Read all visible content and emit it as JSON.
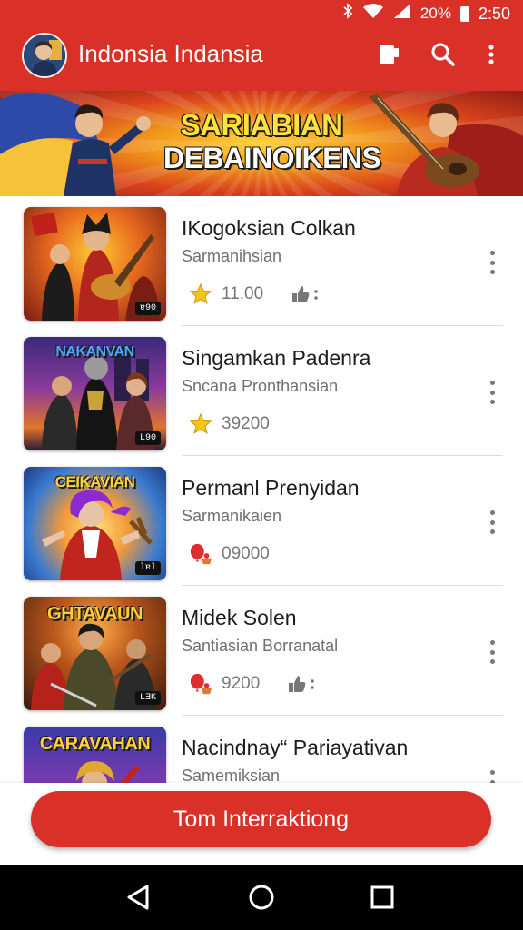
{
  "status_bar": {
    "battery": "20%",
    "time": "2:50"
  },
  "app_bar": {
    "title": "Indonsia Indansia"
  },
  "banner": {
    "line1": "SARIABIAN",
    "line2": "DEBAINOIKENS"
  },
  "items": [
    {
      "title": "IKogoksian Colkan",
      "subtitle": "Sarmanihsian",
      "meta_icon": "star-icon",
      "value": "11.00",
      "extra_icon": "thumb-icon",
      "thumb_title": "",
      "thumb_badge": "ɐ90"
    },
    {
      "title": "Singamkan Padenra",
      "subtitle": "Sncana Pronthansian",
      "meta_icon": "star-icon",
      "value": "39200",
      "extra_icon": "",
      "thumb_title": "NAKANVAN",
      "thumb_badge": "L90"
    },
    {
      "title": "Permanl Prenyidan",
      "subtitle": "Sarmanikaien",
      "meta_icon": "balloon-icon",
      "value": "09000",
      "extra_icon": "",
      "thumb_title": "CEIKAVIAN",
      "thumb_badge": "ƖɐƖ"
    },
    {
      "title": "Midek Solen",
      "subtitle": "Santiasian Borranatal",
      "meta_icon": "balloon-icon",
      "value": "9200",
      "extra_icon": "thumb-icon",
      "thumb_title": "GHTAVAUN",
      "thumb_badge": "LƎK"
    },
    {
      "title": "Nacindnay“ Pariayativan",
      "subtitle": "Samemiksian",
      "meta_icon": "",
      "value": "",
      "extra_icon": "",
      "thumb_title": "CARAVAHAN",
      "thumb_badge": ""
    }
  ],
  "action": {
    "label": "Tom Interraktiong"
  },
  "colors": {
    "primary": "#d93128",
    "star": "#f6c515",
    "balloon": "#e02d2d"
  }
}
